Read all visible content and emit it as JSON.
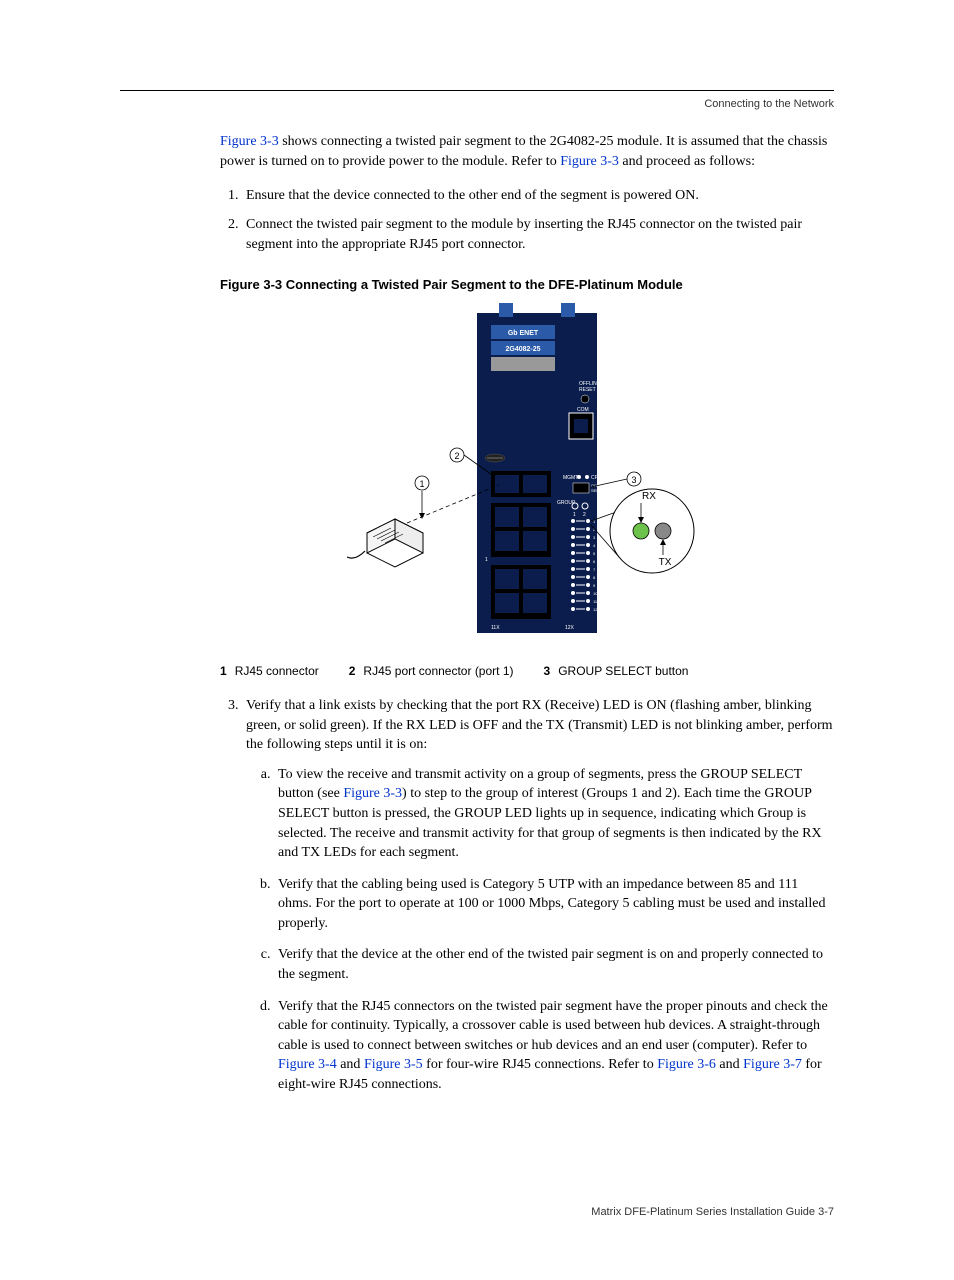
{
  "header": {
    "section": "Connecting to the Network"
  },
  "intro": {
    "fig33a": "Figure 3-3",
    "part1": " shows connecting a twisted pair segment to the 2G4082-25 module. It is assumed that the chassis power is turned on to provide power to the module. Refer to ",
    "fig33b": "Figure 3-3",
    "part2": " and proceed as follows:"
  },
  "steps": {
    "s1": "Ensure that the device connected to the other end of the segment is powered ON.",
    "s2": "Connect the twisted pair segment to the module by inserting the RJ45 connector on the twisted pair segment into the appropriate RJ45 port connector."
  },
  "figcap": "Figure 3-3     Connecting a Twisted Pair Segment to the DFE-Platinum Module",
  "legend": {
    "n1": "1",
    "t1": "RJ45 connector",
    "n2": "2",
    "t2": "RJ45 port connector (port 1)",
    "n3": "3",
    "t3": "GROUP SELECT button"
  },
  "step3": {
    "lead": "Verify that a link exists by checking that the port RX (Receive) LED is ON (flashing amber, blinking green, or solid green). If the RX LED is OFF and the TX (Transmit) LED is not blinking amber, perform the following steps until it is on:",
    "a1": "To view the receive and transmit activity on a group of segments, press the GROUP SELECT button (see ",
    "a_fig": "Figure 3-3",
    "a2": ") to step to the group of interest (Groups 1 and 2). Each time the GROUP SELECT button is pressed, the GROUP LED lights up in sequence, indicating which Group is selected. The receive and transmit activity for that group of segments is then indicated by the RX and TX LEDs for each segment.",
    "b": "Verify that the cabling being used is Category 5 UTP with an impedance between 85 and 111 ohms. For the port to operate at 100 or 1000 Mbps, Category 5 cabling must be used and installed properly.",
    "c": "Verify that the device at the other end of the twisted pair segment is on and properly connected to the segment.",
    "d1": "Verify that the RJ45 connectors on the twisted pair segment have the proper pinouts and check the cable for continuity. Typically, a crossover cable is used between hub devices. A straight-through cable is used to connect between switches or hub devices and an end user (computer). Refer to ",
    "d_f34": "Figure 3-4",
    "d2": " and ",
    "d_f35": "Figure 3-5",
    "d3": " for four-wire RJ45 connections. Refer to ",
    "d_f36": "Figure 3-6",
    "d4": " and ",
    "d_f37": "Figure 3-7",
    "d5": " for eight-wire RJ45 connections."
  },
  "footer": {
    "text": "Matrix DFE-Platinum Series Installation Guide    3-7"
  },
  "svgtxt": {
    "gbenet": "Gb ENET",
    "model": "2G4082-25",
    "offline": "OFFLINE/",
    "reset": "RESET",
    "com": "COM",
    "mgmt": "MGMT",
    "cpu": "CPU",
    "group": "GROUP",
    "select": "SELECT",
    "group2": "GROUP",
    "rx": "RX",
    "tx": "TX",
    "l1": "1",
    "l2": "2",
    "l3": "3"
  }
}
